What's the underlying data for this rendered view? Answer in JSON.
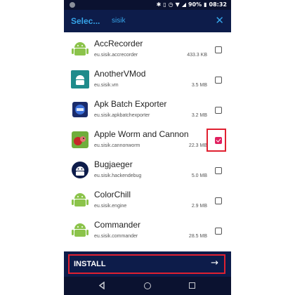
{
  "status_bar": {
    "battery_pct": "90%",
    "time": "08:32",
    "icons": [
      "notification-dot-icon",
      "bluetooth-icon",
      "vibrate-icon",
      "alarm-icon",
      "wifi-icon",
      "signal-icon",
      "battery-icon"
    ]
  },
  "app_bar": {
    "title": "Selec...",
    "search_text": "sisik",
    "close_symbol": "✕"
  },
  "apps": [
    {
      "name": "AccRecorder",
      "package": "eu.sisik.accrecorder",
      "size": "433.3 KB",
      "checked": false,
      "icon": "android-robot-icon"
    },
    {
      "name": "AnotherVMod",
      "package": "eu.sisik.vm",
      "size": "3.5 MB",
      "checked": false,
      "icon": "android-teal-icon"
    },
    {
      "name": "Apk Batch Exporter",
      "package": "eu.sisik.apkbatchexporter",
      "size": "3.2 MB",
      "checked": false,
      "icon": "apk-icon"
    },
    {
      "name": "Apple Worm and Cannon",
      "package": "eu.sisik.cannonworm",
      "size": "22.3 MB",
      "checked": true,
      "icon": "worm-apple-icon"
    },
    {
      "name": "Bugjaeger",
      "package": "eu.sisik.hackendebug",
      "size": "5.0 MB",
      "checked": false,
      "icon": "bug-robot-icon"
    },
    {
      "name": "ColorChill",
      "package": "eu.sisik.engine",
      "size": "2.9 MB",
      "checked": false,
      "icon": "android-robot-icon"
    },
    {
      "name": "Commander",
      "package": "eu.sisik.commander",
      "size": "28.5 MB",
      "checked": false,
      "icon": "android-robot-icon"
    }
  ],
  "bottom": {
    "install_label": "INSTALL",
    "arrow": "→"
  },
  "nav": {
    "back": "back-icon",
    "home": "home-icon",
    "recents": "recents-icon"
  }
}
